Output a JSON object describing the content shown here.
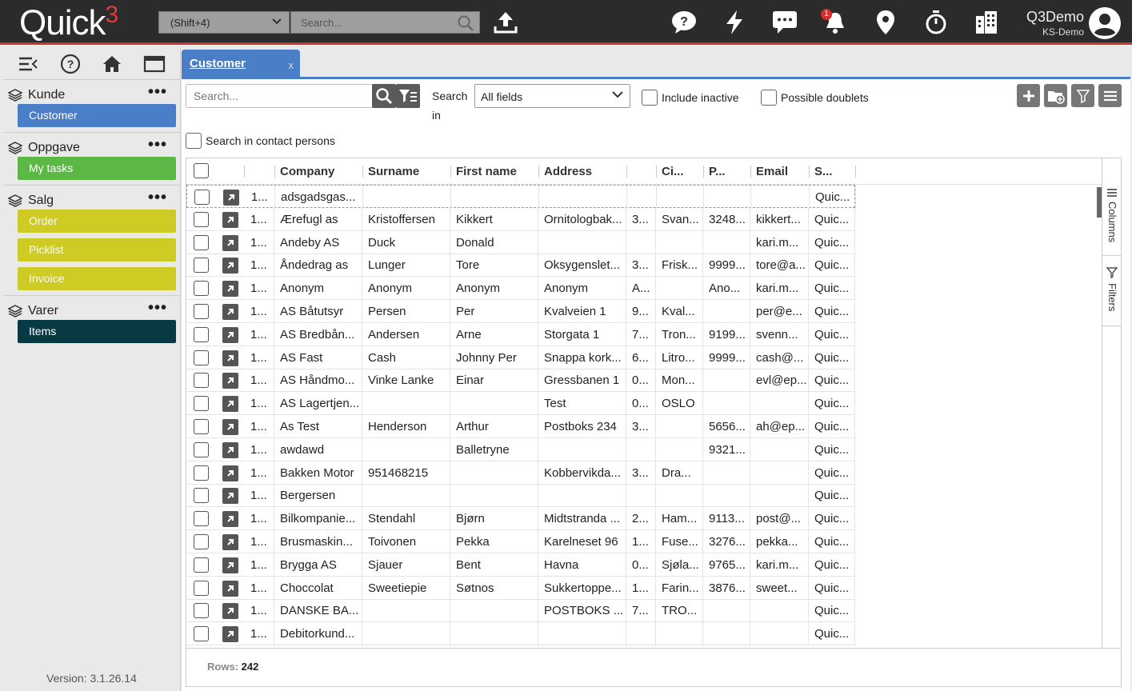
{
  "app": {
    "logo_text": "Quick",
    "logo_suffix": "3",
    "shortcut_label": "(Shift+4)",
    "search_placeholder": "Search...",
    "notification_count": "1",
    "user_name": "Q3Demo",
    "user_company": "KS-Demo",
    "accent_color": "#4a7ec7",
    "brand_red": "#c0392b"
  },
  "sidebar": {
    "groups": [
      {
        "label": "Kunde",
        "items": [
          {
            "label": "Customer",
            "color": "blue"
          }
        ]
      },
      {
        "label": "Oppgave",
        "items": [
          {
            "label": "My tasks",
            "color": "green"
          }
        ]
      },
      {
        "label": "Salg",
        "items": [
          {
            "label": "Order",
            "color": "yellow"
          },
          {
            "label": "Picklist",
            "color": "yellow"
          },
          {
            "label": "Invoice",
            "color": "yellow"
          }
        ]
      },
      {
        "label": "Varer",
        "items": [
          {
            "label": "Items",
            "color": "dark"
          }
        ]
      }
    ],
    "version": "Version: 3.1.26.14"
  },
  "tab": {
    "label": "Customer",
    "close": "x"
  },
  "toolbar": {
    "search_placeholder": "Search...",
    "search_in_label": "Search in",
    "search_field_value": "All fields",
    "include_inactive_label": "Include inactive",
    "possible_doublets_label": "Possible doublets",
    "search_contacts_label": "Search in contact persons"
  },
  "grid": {
    "columns": [
      "",
      "Company",
      "Surname",
      "First name",
      "Address",
      "",
      "Ci...",
      "P...",
      "Email",
      "S..."
    ],
    "rows": [
      [
        "1...",
        "adsgadsgas...",
        "",
        "",
        "",
        "",
        "",
        "",
        "",
        "Quic..."
      ],
      [
        "1...",
        "Ærefugl as",
        "Kristoffersen",
        "Kikkert",
        "Ornitologbak...",
        "3...",
        "Svan...",
        "3248...",
        "kikkert...",
        "Quic..."
      ],
      [
        "1...",
        "Andeby AS",
        "Duck",
        "Donald",
        "",
        "",
        "",
        "",
        "kari.m...",
        "Quic..."
      ],
      [
        "1...",
        "Åndedrag as",
        "Lunger",
        "Tore",
        "Oksygenslet...",
        "3...",
        "Frisk...",
        "9999...",
        "tore@a...",
        "Quic..."
      ],
      [
        "1...",
        "Anonym",
        "Anonym",
        "Anonym",
        "Anonym",
        "A...",
        "",
        "Ano...",
        "kari.m...",
        "Quic..."
      ],
      [
        "1...",
        "AS Båtutsyr",
        "Persen",
        "Per",
        "Kvalveien 1",
        "9...",
        "Kval...",
        "",
        "per@e...",
        "Quic..."
      ],
      [
        "1...",
        "AS Bredbån...",
        "Andersen",
        "Arne",
        "Storgata 1",
        "7...",
        "Tron...",
        "9199...",
        "svenn...",
        "Quic..."
      ],
      [
        "1...",
        "AS Fast",
        "Cash",
        "Johnny Per",
        "Snappa kork...",
        "6...",
        "Litro...",
        "9999...",
        "cash@...",
        "Quic..."
      ],
      [
        "1...",
        "AS Håndmo...",
        "Vinke Lanke",
        "Einar",
        "Gressbanen 1",
        "0...",
        "Mon...",
        "",
        "evl@ep...",
        "Quic..."
      ],
      [
        "1...",
        "AS Lagertjen...",
        "",
        "",
        "Test",
        "0...",
        "OSLO",
        "",
        "",
        "Quic..."
      ],
      [
        "1...",
        "As Test",
        "Henderson",
        "Arthur",
        "Postboks 234",
        "3...",
        "",
        "5656...",
        "ah@ep...",
        "Quic..."
      ],
      [
        "1...",
        "awdawd",
        "",
        "Balletryne",
        "",
        "",
        "",
        "9321...",
        "",
        "Quic..."
      ],
      [
        "1...",
        "Bakken Motor",
        "951468215",
        "",
        "Kobbervikda...",
        "3...",
        "Dra...",
        "",
        "",
        "Quic..."
      ],
      [
        "1...",
        "Bergersen",
        "",
        "",
        "",
        "",
        "",
        "",
        "",
        "Quic..."
      ],
      [
        "1...",
        "Bilkompanie...",
        "Stendahl",
        "Bjørn",
        "Midtstranda ...",
        "2...",
        "Ham...",
        "9113...",
        "post@...",
        "Quic..."
      ],
      [
        "1...",
        "Brusmaskin...",
        "Toivonen",
        "Pekka",
        "Karelneset 96",
        "1...",
        "Fuse...",
        "3276...",
        "pekka...",
        "Quic..."
      ],
      [
        "1...",
        "Brygga AS",
        "Sjauer",
        "Bent",
        "Havna",
        "0...",
        "Sjøla...",
        "9765...",
        "kari.m...",
        "Quic..."
      ],
      [
        "1...",
        "Choccolat",
        "Sweetiepie",
        "Søtnos",
        "Sukkertoppe...",
        "1...",
        "Farin...",
        "3876...",
        "sweet...",
        "Quic..."
      ],
      [
        "1...",
        "DANSKE BA...",
        "",
        "",
        "POSTBOKS ...",
        "7...",
        "TRO...",
        "",
        "",
        "Quic..."
      ],
      [
        "1...",
        "Debitorkund...",
        "",
        "",
        "",
        "",
        "",
        "",
        "",
        "Quic..."
      ]
    ],
    "side_tabs": [
      "Columns",
      "Filters"
    ],
    "rows_label": "Rows:",
    "rows_count": "242"
  }
}
